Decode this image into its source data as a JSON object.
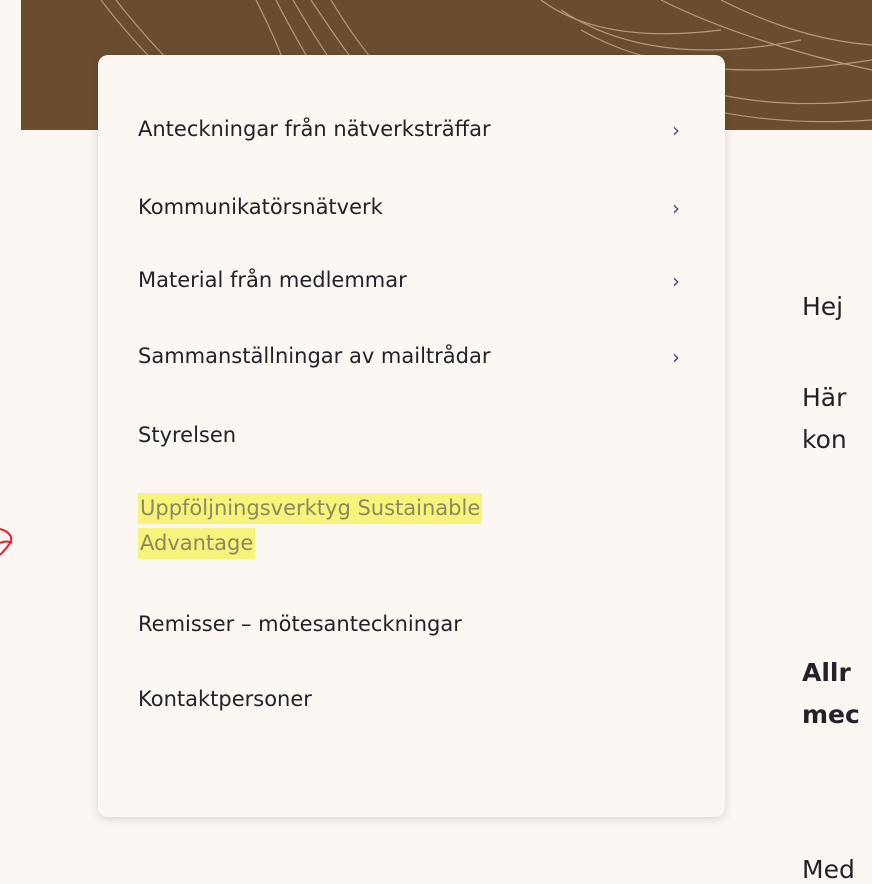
{
  "menu": {
    "items": [
      {
        "label": "Anteckningar från nätverksträffar",
        "has_submenu": true
      },
      {
        "label": "Kommunikatörsnätverk",
        "has_submenu": true
      },
      {
        "label": "Material från medlemmar",
        "has_submenu": true
      },
      {
        "label": "Sammanställningar av mailtrådar",
        "has_submenu": true
      },
      {
        "label": "Styrelsen",
        "has_submenu": false
      },
      {
        "label_line1": "Uppföljningsverktyg Sustainable",
        "label_line2": "Advantage",
        "highlighted": true
      },
      {
        "label": "Remisser – mötesanteckningar",
        "has_submenu": false
      },
      {
        "label": "Kontaktpersoner",
        "has_submenu": false
      }
    ],
    "chevron": "›"
  },
  "page_text": {
    "line1": "Hej",
    "line2": "Här",
    "line3": "kon",
    "bold1": "Allr",
    "bold2": "mec",
    "bottom": "Med"
  },
  "colors": {
    "background": "#fdf7f3",
    "hero": "#6a4d2f",
    "highlight": "#f7f37c",
    "highlight_text": "#8a8a5a",
    "chevron": "#4b4a7c",
    "annotation": "#e0202a"
  }
}
